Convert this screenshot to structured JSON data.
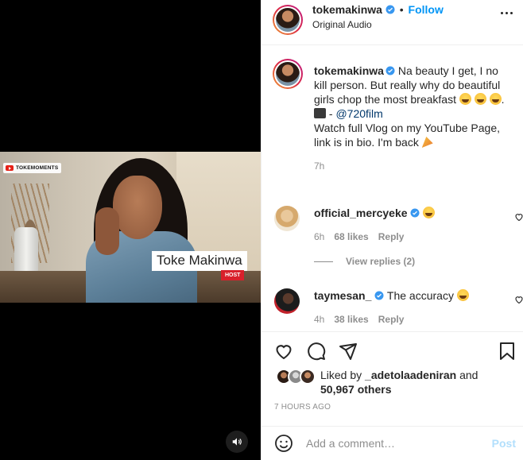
{
  "video": {
    "channel_badge": "TOKEMOMENTS",
    "lower_third_name": "Toke Makinwa",
    "lower_third_role": "HOST"
  },
  "header": {
    "username": "tokemakinwa",
    "separator": "•",
    "follow_label": "Follow",
    "audio_label": "Original Audio"
  },
  "caption": {
    "username": "tokemakinwa",
    "text_1": " Na beauty I get, I no kill person. But really why do beautiful girls chop the most breakfast ",
    "text_2": ".",
    "dash": " - ",
    "mention": "@720film",
    "text_3": "Watch full Vlog on my YouTube Page, link is in bio. I'm back ",
    "time": "7h"
  },
  "comments": [
    {
      "username": "official_mercyeke",
      "text": "",
      "time": "6h",
      "likes": "68 likes",
      "reply": "Reply",
      "view_replies": "View replies (2)"
    },
    {
      "username": "taymesan_",
      "text": " The accuracy ",
      "time": "4h",
      "likes": "38 likes",
      "reply": "Reply"
    }
  ],
  "likes": {
    "prefix": "Liked by ",
    "first_user": "_adetolaadeniran",
    "middle": " and",
    "others": "50,967 others"
  },
  "timestamp": "7 HOURS AGO",
  "add_comment": {
    "placeholder": "Add a comment…",
    "post_label": "Post"
  },
  "colors": {
    "link_blue": "#0095f6",
    "verified_blue": "#3897f0",
    "post_disabled": "#b2dffc",
    "muted": "#8e8e8e"
  },
  "icons": [
    "youtube-icon",
    "volume-icon",
    "verified-icon",
    "more-options-icon",
    "heart-icon",
    "comment-icon",
    "share-icon",
    "bookmark-icon",
    "emoji-icon"
  ]
}
